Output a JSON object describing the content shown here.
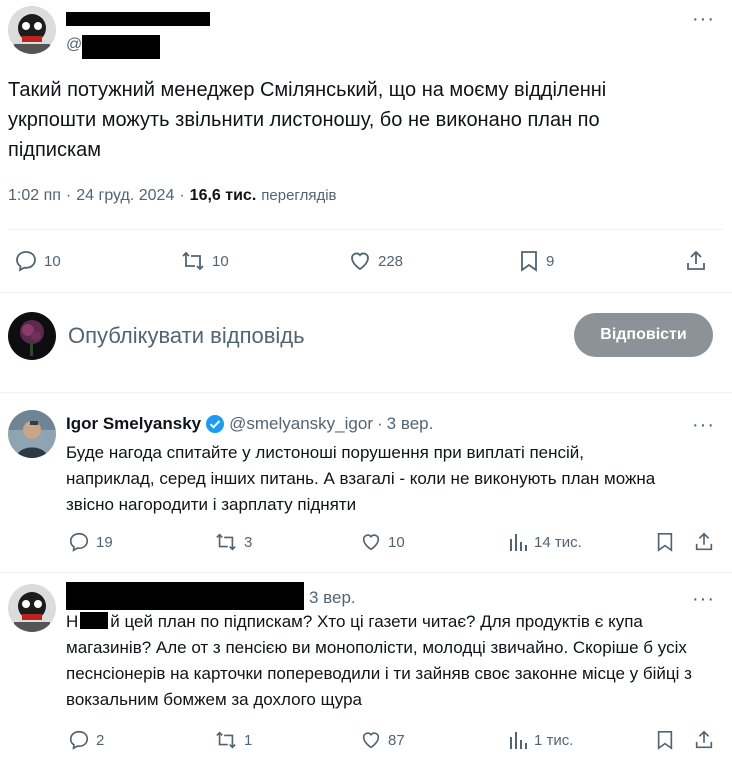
{
  "main_tweet": {
    "handle_prefix": "@",
    "text": "Такий потужний менеджер Смілянський, що на моєму відділенні укрпошти можуть звільнити листоношу, бо не виконано план по підпискам",
    "time": "1:02 пп",
    "date": "24 груд. 2024",
    "views_count": "16,6 тис.",
    "views_label": "переглядів",
    "actions": {
      "replies": "10",
      "reposts": "10",
      "likes": "228",
      "bookmarks": "9"
    }
  },
  "composer": {
    "placeholder": "Опублікувати відповідь",
    "button_label": "Відповісти"
  },
  "replies": [
    {
      "name": "Igor Smelyansky",
      "handle": "@smelyansky_igor",
      "time": "3 вер.",
      "verified": true,
      "text": "Буде нагода спитайте у листоноші порушення при виплаті пенсій, наприклад, серед інших питань. А взагалі - коли не виконують план можна звісно нагородити і зарплату підняти",
      "actions": {
        "replies": "19",
        "reposts": "3",
        "likes": "10",
        "views": "14 тис."
      }
    },
    {
      "time": "3 вер.",
      "text_prefix": "Н",
      "text": "й цей план по підпискам? Хто ці газети читає? Для продуктів є купа магазинів? Але от з пенсією ви монополісти, молодці звичайно. Скоріше б усіх песнсіонерів на карточки попереводили і ти зайняв своє законне місце у бійці з вокзальним бомжем за дохлого щура",
      "actions": {
        "replies": "2",
        "reposts": "1",
        "likes": "87",
        "views": "1 тис."
      }
    }
  ],
  "colors": {
    "accent": "#1d9bf0",
    "muted": "#536471",
    "text": "#0f1419",
    "button_disabled": "#8b9399"
  }
}
